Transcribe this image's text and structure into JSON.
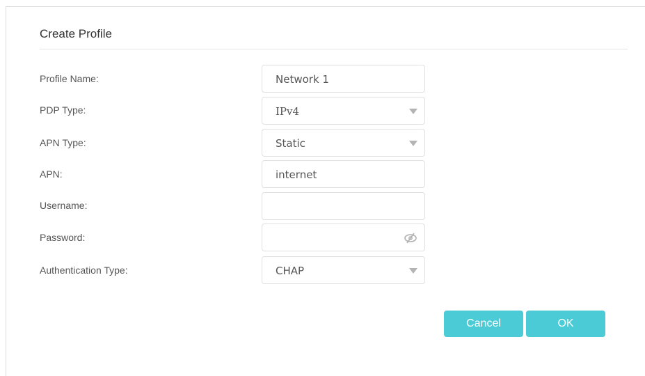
{
  "dialog": {
    "title": "Create Profile"
  },
  "form": {
    "profile_name": {
      "label": "Profile Name:",
      "value": "Network 1"
    },
    "pdp_type": {
      "label": "PDP Type:",
      "value": "IPv4",
      "control": "select"
    },
    "apn_type": {
      "label": "APN Type:",
      "value": "Static",
      "control": "select"
    },
    "apn": {
      "label": "APN:",
      "value": "internet"
    },
    "username": {
      "label": "Username:",
      "value": ""
    },
    "password": {
      "label": "Password:",
      "value": "",
      "icon": "eye-slash-icon"
    },
    "auth_type": {
      "label": "Authentication Type:",
      "value": "CHAP",
      "control": "select"
    }
  },
  "buttons": {
    "cancel_label": "Cancel",
    "ok_label": "OK"
  },
  "colors": {
    "button_accent": "#4acbd6",
    "label_text": "#555555",
    "border": "#e0e0e0"
  }
}
